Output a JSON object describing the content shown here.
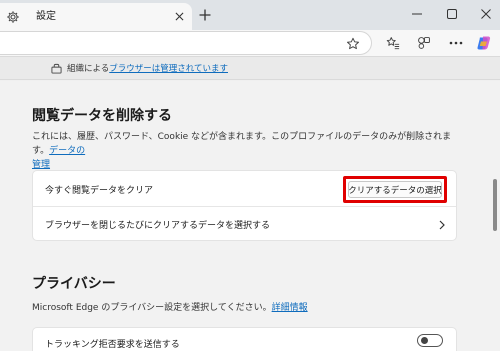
{
  "tab": {
    "title": "設定",
    "icon": "gear-icon"
  },
  "window": {
    "new_tab": "+"
  },
  "managed_banner": {
    "prefix": "組織による",
    "link": "ブラウザーは管理されています"
  },
  "clear_section": {
    "heading": "閲覧データを削除する",
    "description": "これには、履歴、パスワード、Cookie などが含まれます。このプロファイルのデータのみが削除されます。",
    "description_link_line1": "データの",
    "description_link_line2": "管理",
    "rows": [
      {
        "label": "今すぐ閲覧データをクリア",
        "button": "クリアするデータの選択"
      },
      {
        "label": "ブラウザーを閉じるたびにクリアするデータを選択する"
      }
    ]
  },
  "privacy_section": {
    "heading": "プライバシー",
    "description": "Microsoft Edge のプライバシー設定を選択してください。",
    "description_link": "詳細情報",
    "rows": [
      {
        "label": "トラッキング拒否要求を送信する",
        "toggle_on": false
      }
    ]
  },
  "colors": {
    "accent": "#0f6cbd",
    "highlight": "#e00000"
  }
}
